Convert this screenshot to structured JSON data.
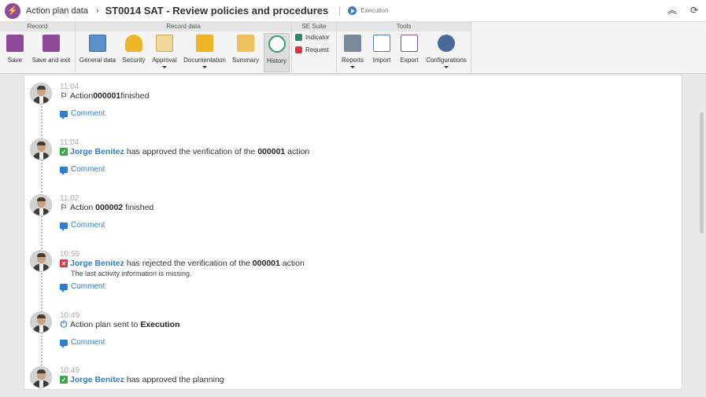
{
  "header": {
    "breadcrumb_root": "Action plan data",
    "title": "ST0014 SAT - Review policies and procedures",
    "status": "Execution"
  },
  "toolbar": {
    "groups": {
      "record": "Record",
      "record_data": "Record data",
      "se_suite": "SE Suite",
      "tools": "Tools"
    },
    "buttons": {
      "save": "Save",
      "save_exit": "Save and exit",
      "general_data": "General data",
      "security": "Security",
      "approval": "Approval",
      "documentation": "Documentation",
      "summary": "Summary",
      "history": "History",
      "indicator": "Indicator",
      "request": "Request",
      "reports": "Reports",
      "import": "Import",
      "export": "Export",
      "configurations": "Configurations"
    }
  },
  "history": [
    {
      "time": "11:04",
      "icon": "flag-icon",
      "text_pre": "Action ",
      "bold": "000001",
      "text_post": " finished",
      "comment": "Comment"
    },
    {
      "time": "11:04",
      "icon": "check-icon",
      "user": "Jorge Benitez",
      "text_pre": "has approved the verification of the ",
      "bold": "000001",
      "text_post": " action",
      "comment": "Comment"
    },
    {
      "time": "11:02",
      "icon": "flag-icon",
      "text_pre": "Action ",
      "bold": "000002",
      "text_post": " finished",
      "comment": "Comment"
    },
    {
      "time": "10:59",
      "icon": "reject-icon",
      "user": "Jorge Benitez",
      "text_pre": "has rejected the verification of the ",
      "bold": "000001",
      "text_post": " action",
      "detail": "The last activity information is missing.",
      "comment": "Comment"
    },
    {
      "time": "10:49",
      "icon": "power-icon",
      "text_pre": "Action plan sent to ",
      "bold": "Execution",
      "text_post": "",
      "comment": "Comment"
    },
    {
      "time": "10:49",
      "icon": "check-icon",
      "user": "Jorge Benitez",
      "text_pre": "has approved the planning",
      "bold": "",
      "text_post": ""
    }
  ],
  "colors": {
    "accent": "#2a7fd4",
    "app_icon": "#8e4a9a",
    "approved": "#3aa845",
    "rejected": "#d9363e"
  }
}
